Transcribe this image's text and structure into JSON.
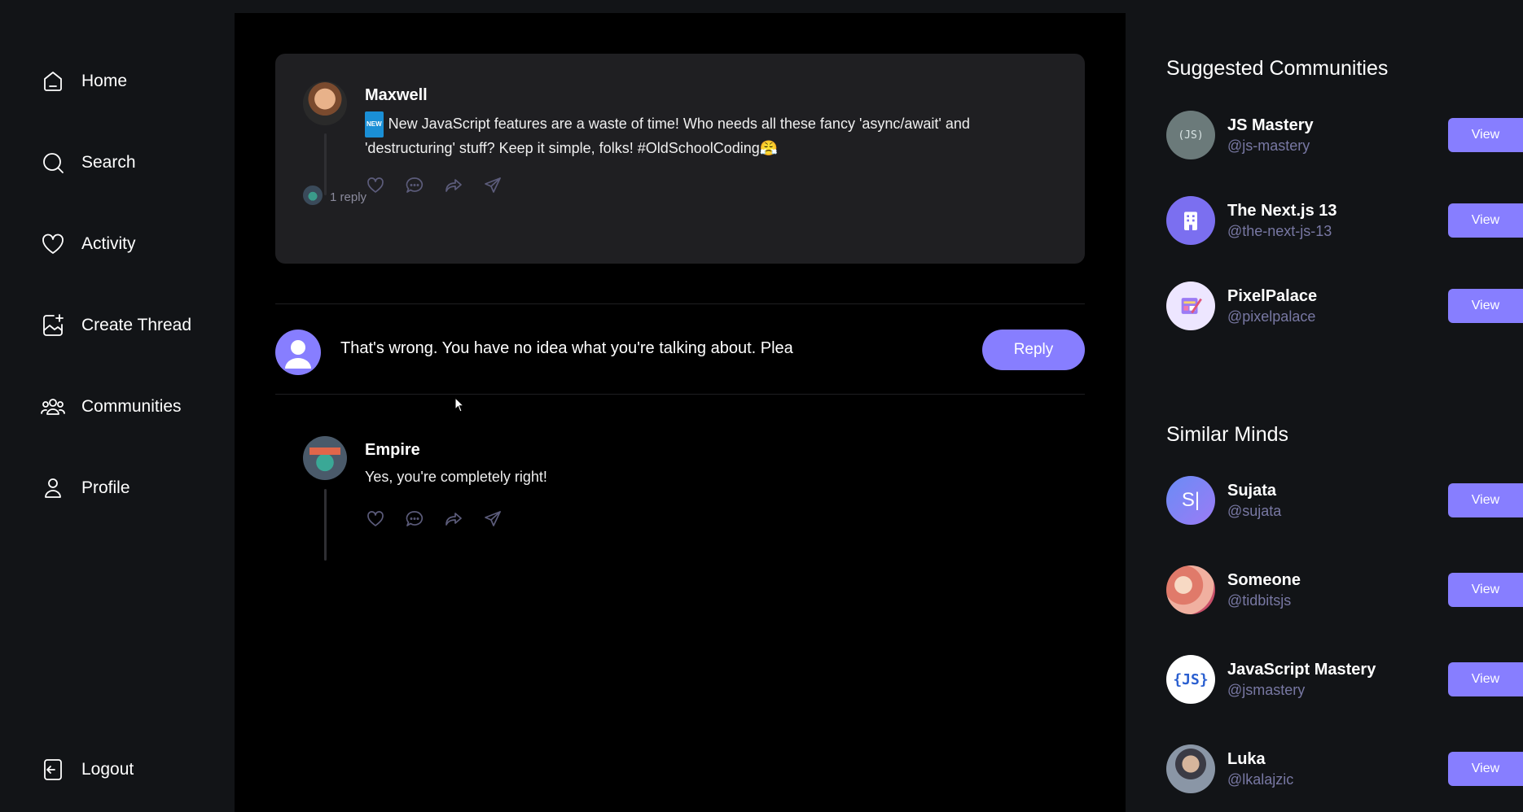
{
  "nav": {
    "items": [
      {
        "label": "Home",
        "icon": "home-icon"
      },
      {
        "label": "Search",
        "icon": "search-icon"
      },
      {
        "label": "Activity",
        "icon": "heart-icon"
      },
      {
        "label": "Create Thread",
        "icon": "create-thread-icon"
      },
      {
        "label": "Communities",
        "icon": "communities-icon"
      },
      {
        "label": "Profile",
        "icon": "user-icon"
      }
    ],
    "logout": "Logout"
  },
  "thread": {
    "author": "Maxwell",
    "badge": "NEW",
    "text": "New JavaScript features are a waste of time! Who needs all these fancy 'async/await' and 'destructuring' stuff? Keep it simple, folks! #OldSchoolCoding",
    "emoji": "😤",
    "replies": "1 reply"
  },
  "comment_form": {
    "value": "That's wrong. You have no idea what you're talking about. Plea",
    "button": "Reply"
  },
  "reply": {
    "author": "Empire",
    "text": "Yes, you're completely right!"
  },
  "suggested_communities": {
    "title": "Suggested Communities",
    "items": [
      {
        "name": "JS Mastery",
        "handle": "@js-mastery",
        "button": "View"
      },
      {
        "name": "The Next.js 13",
        "handle": "@the-next-js-13",
        "button": "View"
      },
      {
        "name": "PixelPalace",
        "handle": "@pixelpalace",
        "button": "View"
      }
    ]
  },
  "similar_minds": {
    "title": "Similar Minds",
    "items": [
      {
        "name": "Sujata",
        "handle": "@sujata",
        "button": "View",
        "initial": "S|"
      },
      {
        "name": "Someone",
        "handle": "@tidbitsjs",
        "button": "View"
      },
      {
        "name": "JavaScript Mastery",
        "handle": "@jsmastery",
        "button": "View"
      },
      {
        "name": "Luka",
        "handle": "@lkalajzic",
        "button": "View"
      }
    ]
  },
  "colors": {
    "accent": "#877eff",
    "background": "#000000",
    "sidebar": "#121417",
    "card": "#1f1f22",
    "muted": "#7878a3"
  }
}
